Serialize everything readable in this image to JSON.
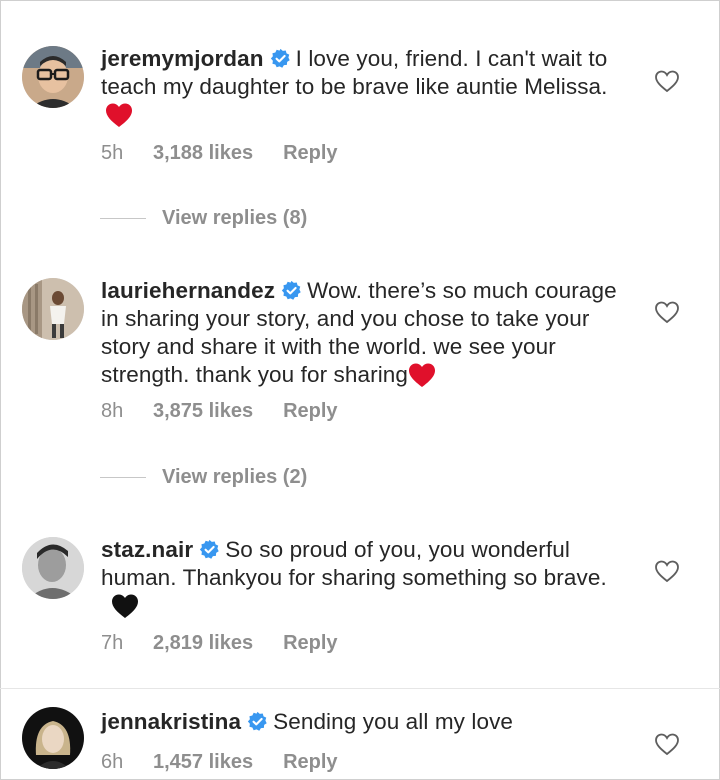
{
  "comments": [
    {
      "username": "jeremymjordan",
      "text": "I love you, friend. I can't wait to teach my daughter to be brave like auntie Melissa.",
      "emoji": "red-heart",
      "time": "5h",
      "likes": "3,188 likes",
      "reply_label": "Reply",
      "view_replies": "View replies (8)"
    },
    {
      "username": "lauriehernandez",
      "text": "Wow. there’s so much courage in sharing your story, and you chose to take your story and share it with the world. we see your strength. thank you for sharing",
      "emoji": "red-heart",
      "time": "8h",
      "likes": "3,875 likes",
      "reply_label": "Reply",
      "view_replies": "View replies (2)"
    },
    {
      "username": "staz.nair",
      "text": "So so proud of you, you wonderful human. Thankyou for sharing something so brave.",
      "emoji": "black-heart",
      "time": "7h",
      "likes": "2,819 likes",
      "reply_label": "Reply"
    },
    {
      "username": "jennakristina",
      "text": "Sending you all my love",
      "time": "6h",
      "likes": "1,457 likes",
      "reply_label": "Reply"
    }
  ],
  "colors": {
    "text": "#262626",
    "muted": "#8e8e8e",
    "verified": "#3897f0",
    "heart_red": "#e0102b",
    "heart_black": "#111111"
  },
  "icons": {
    "verified": "verified-badge-icon",
    "like": "heart-outline-icon"
  }
}
